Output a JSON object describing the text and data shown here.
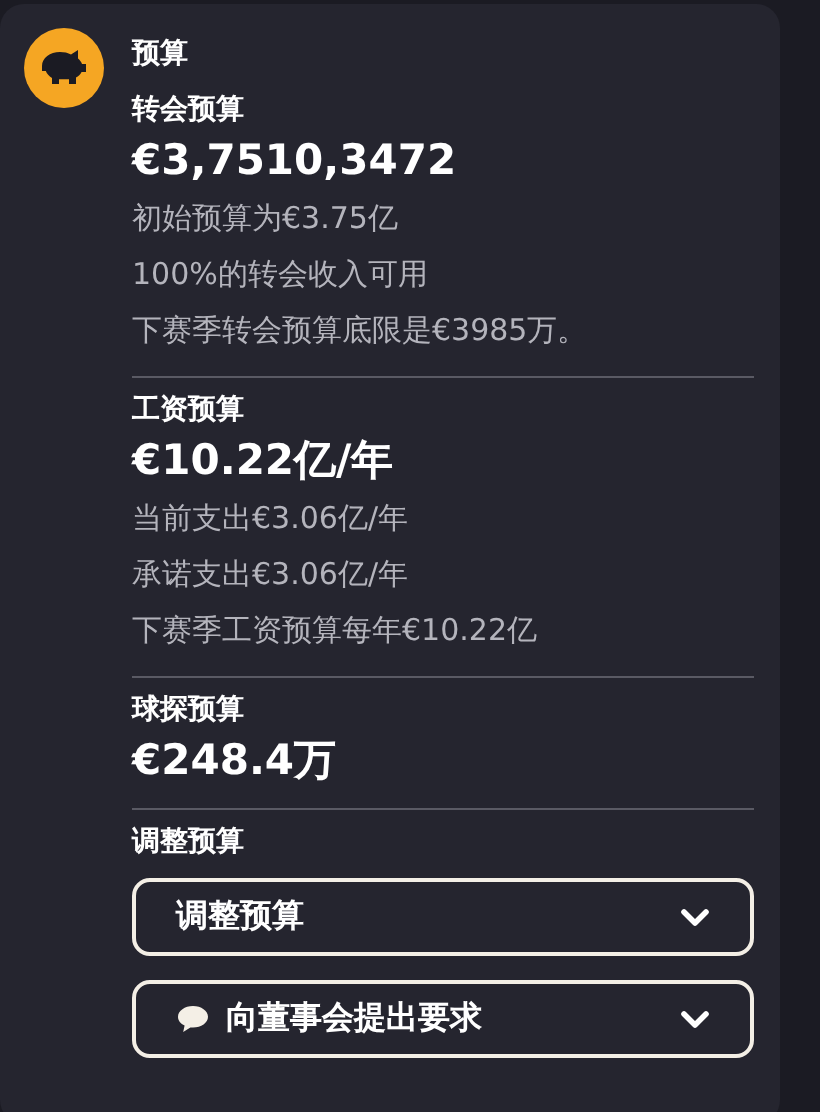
{
  "header": {
    "title": "预算"
  },
  "sections": [
    {
      "title": "转会预算",
      "value": "€3,7510,3472",
      "notes": [
        "初始预算为€3.75亿",
        "100%的转会收入可用",
        "下赛季转会预算底限是€3985万。"
      ]
    },
    {
      "title": "工资预算",
      "value": "€10.22亿/年",
      "notes": [
        "当前支出€3.06亿/年",
        "承诺支出€3.06亿/年",
        "下赛季工资预算每年€10.22亿"
      ]
    },
    {
      "title": "球探预算",
      "value": "€248.4万"
    }
  ],
  "adjust": {
    "title": "调整预算",
    "dropdowns": [
      {
        "label": "调整预算",
        "kind": "plain"
      },
      {
        "label": "向董事会提出要求",
        "kind": "chat"
      }
    ]
  }
}
